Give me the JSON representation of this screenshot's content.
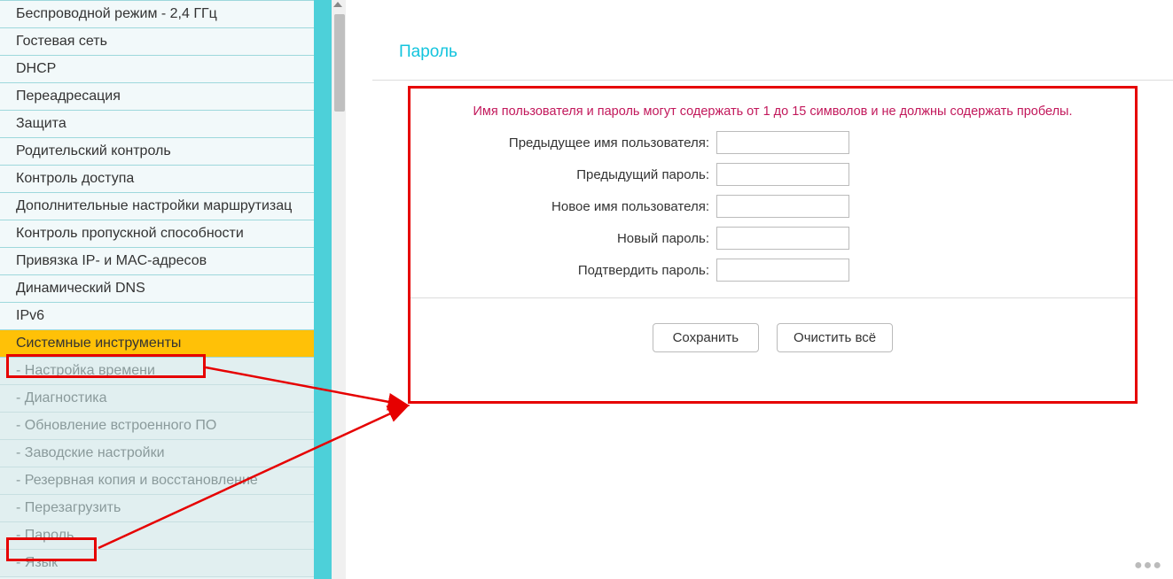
{
  "sidebar": {
    "items": [
      {
        "label": "Беспроводной режим - 2,4 ГГц",
        "type": "item"
      },
      {
        "label": "Гостевая сеть",
        "type": "item"
      },
      {
        "label": "DHCP",
        "type": "item"
      },
      {
        "label": "Переадресация",
        "type": "item"
      },
      {
        "label": "Защита",
        "type": "item"
      },
      {
        "label": "Родительский контроль",
        "type": "item"
      },
      {
        "label": "Контроль доступа",
        "type": "item"
      },
      {
        "label": "Дополнительные настройки маршрутизац",
        "type": "item"
      },
      {
        "label": "Контроль пропускной способности",
        "type": "item"
      },
      {
        "label": "Привязка IP- и MAC-адресов",
        "type": "item"
      },
      {
        "label": "Динамический DNS",
        "type": "item"
      },
      {
        "label": "IPv6",
        "type": "item"
      },
      {
        "label": "Системные инструменты",
        "type": "selected"
      },
      {
        "label": "- Настройка времени",
        "type": "submenu"
      },
      {
        "label": "- Диагностика",
        "type": "submenu"
      },
      {
        "label": "- Обновление встроенного ПО",
        "type": "submenu"
      },
      {
        "label": "- Заводские настройки",
        "type": "submenu"
      },
      {
        "label": "- Резервная копия и восстановление",
        "type": "submenu"
      },
      {
        "label": "- Перезагрузить",
        "type": "submenu"
      },
      {
        "label": "- Пароль",
        "type": "submenu"
      },
      {
        "label": "- Язык",
        "type": "submenu"
      }
    ]
  },
  "content": {
    "title": "Пароль",
    "hint": "Имя пользователя и пароль могут содержать от 1 до 15 символов и не должны содержать пробелы.",
    "fields": {
      "old_username": "Предыдущее имя пользователя:",
      "old_password": "Предыдущий пароль:",
      "new_username": "Новое имя пользователя:",
      "new_password": "Новый пароль:",
      "confirm_password": "Подтвердить пароль:"
    },
    "buttons": {
      "save": "Сохранить",
      "clear": "Очистить всё"
    }
  },
  "annotations": {
    "highlight1": "Системные инструменты",
    "highlight2": "- Пароль"
  }
}
